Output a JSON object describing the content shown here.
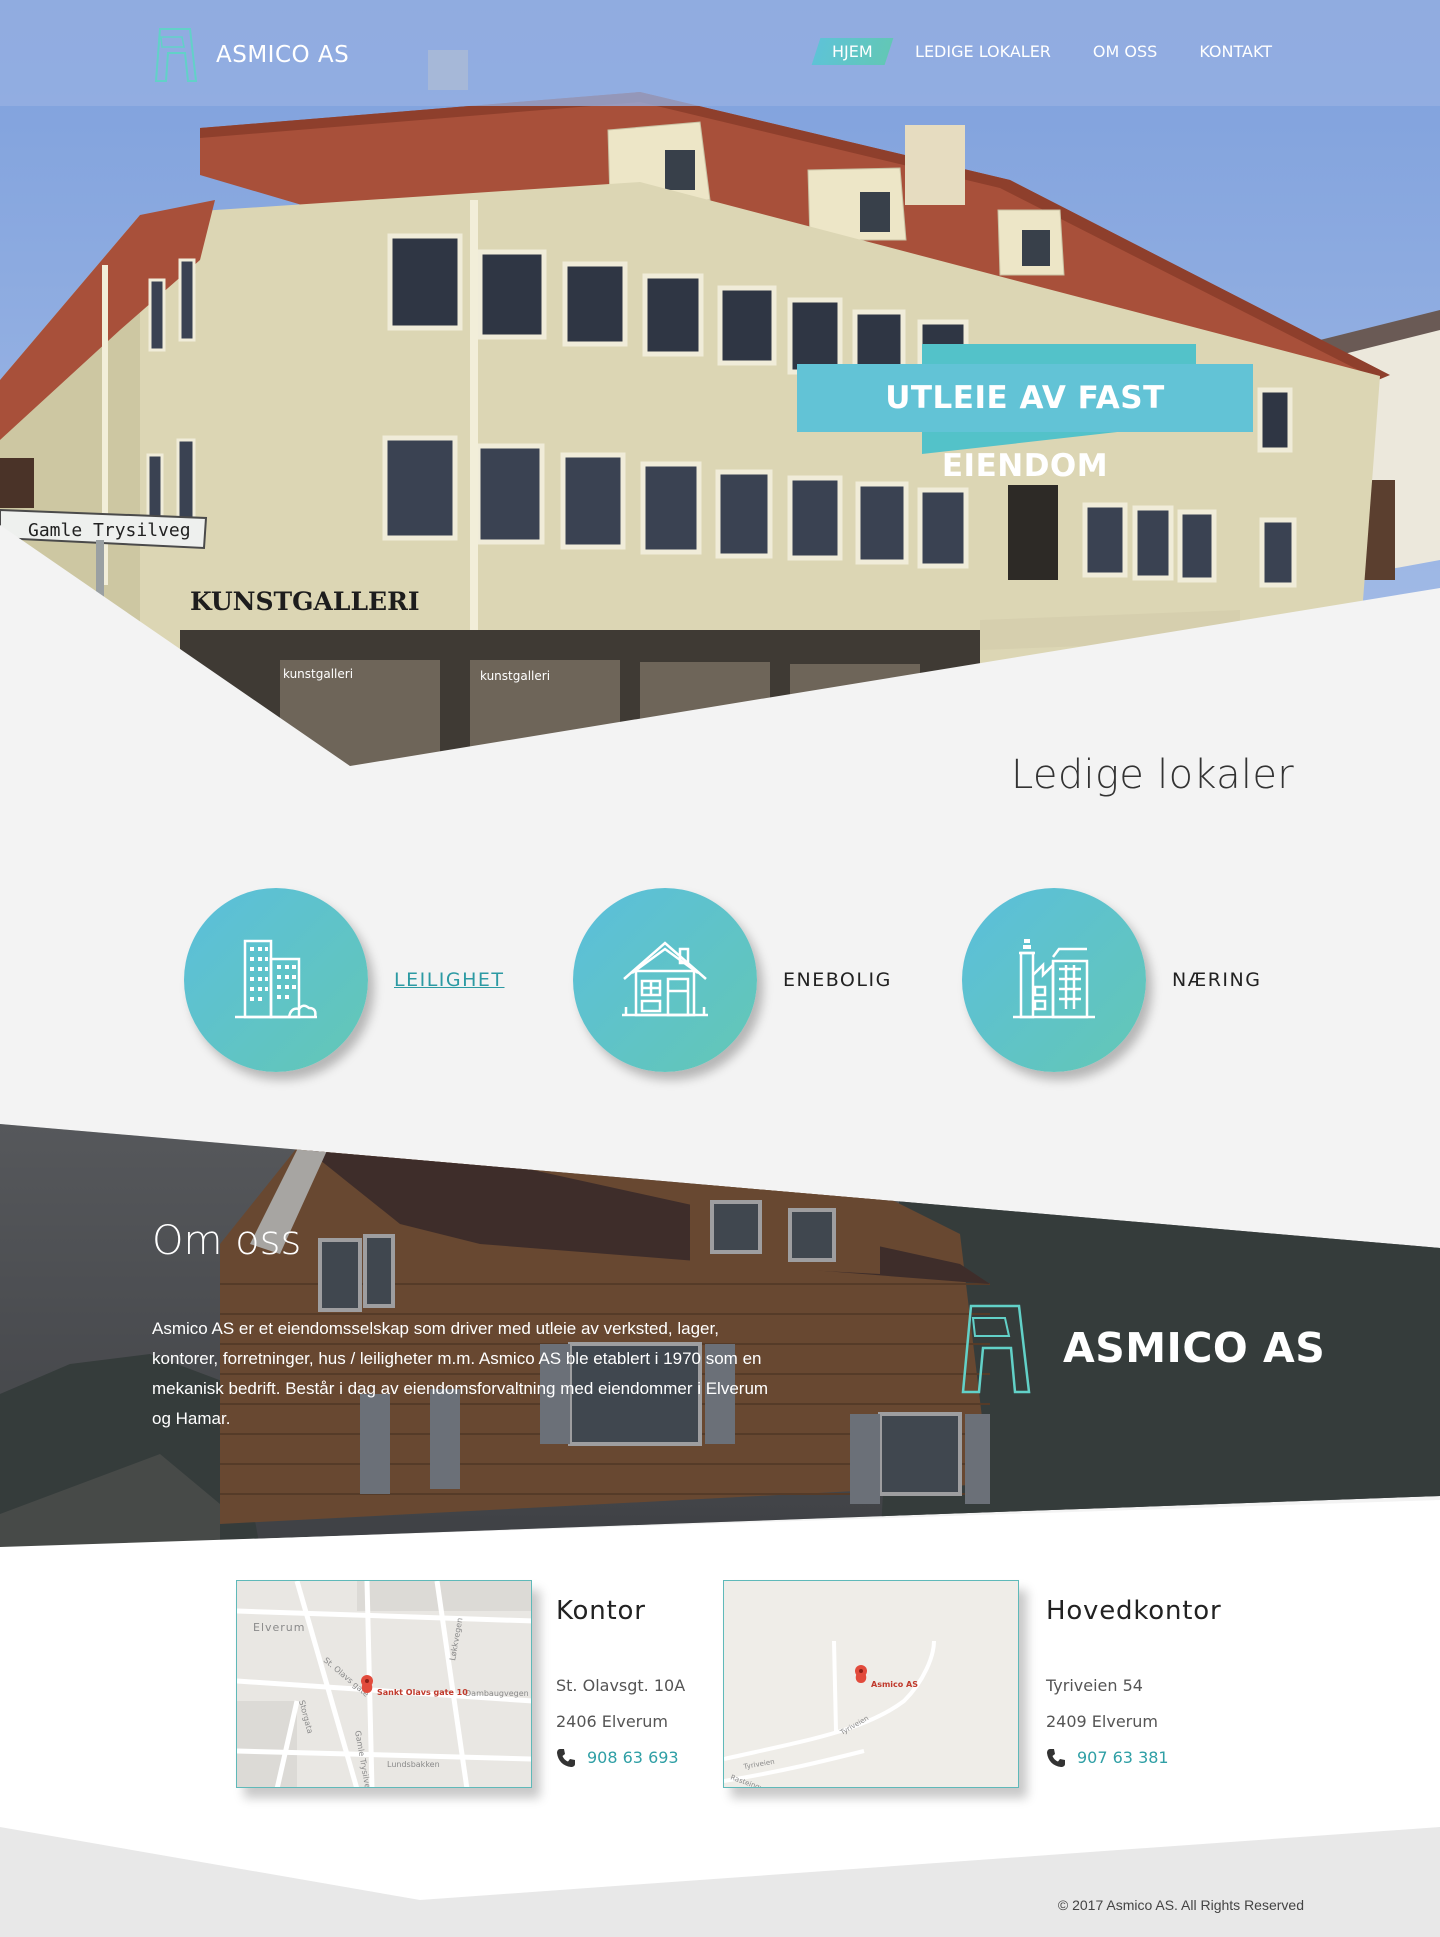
{
  "header": {
    "brand": "ASMICO AS",
    "nav": [
      {
        "label": "HJEM",
        "active": true
      },
      {
        "label": "LEDIGE LOKALER",
        "active": false
      },
      {
        "label": "OM OSS",
        "active": false
      },
      {
        "label": "KONTAKT",
        "active": false
      }
    ]
  },
  "hero": {
    "banner": "UTLEIE AV FAST EIENDOM",
    "street_sign": "Gamle Trysilveg",
    "shop_sign": "KUNSTGALLERI"
  },
  "ledige": {
    "title": "Ledige lokaler",
    "categories": [
      {
        "label": "LEILIGHET",
        "icon": "apartment-building-icon",
        "link": true
      },
      {
        "label": "ENEBOLIG",
        "icon": "house-icon",
        "link": false
      },
      {
        "label": "NÆRING",
        "icon": "factory-icon",
        "link": false
      }
    ]
  },
  "about": {
    "title": "Om oss",
    "text": "Asmico AS er et eiendomsselskap som driver med utleie av verksted, lager, kontorer, forretninger, hus / leiligheter m.m. Asmico AS ble etablert i 1970 som en mekanisk bedrift. Består i dag av eiendomsforvaltning med eiendommer i Elverum og Hamar.",
    "brand": "ASMICO AS"
  },
  "offices": [
    {
      "title": "Kontor",
      "address1": "St. Olavsgt. 10A",
      "address2": "2406 Elverum",
      "phone": "908 63 693",
      "map_label": "Sankt Olavs gate 10",
      "map_town": "Elverum",
      "map_streets": [
        "St. Olavs gate",
        "Storgata",
        "Gamle Trysilveg",
        "Lundsbakken",
        "Dambaugvegen",
        "Løkkvegen"
      ]
    },
    {
      "title": "Hovedkontor",
      "address1": "Tyriveien 54",
      "address2": "2409 Elverum",
      "phone": "907 63 381",
      "map_label": "Asmico AS",
      "map_streets": [
        "Tyriveien",
        "Tyriveien",
        "Rasteingvegen"
      ]
    }
  ],
  "footer": {
    "copyright": "© 2017 Asmico AS. All Rights Reserved"
  },
  "colors": {
    "accent": "#5ec3d6",
    "teal": "#62c7b6",
    "link": "#2f9fa5",
    "nav_bg": "#96afe1"
  }
}
